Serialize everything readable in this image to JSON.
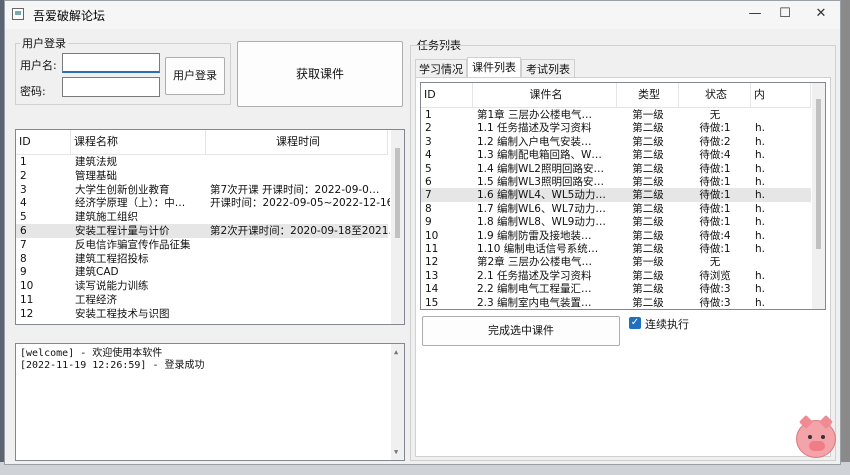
{
  "window": {
    "title": "吾爱破解论坛"
  },
  "login": {
    "group_title": "用户登录",
    "username_label": "用户名:",
    "username_value": "",
    "password_label": "密码:",
    "password_value": "",
    "login_button": "用户登录"
  },
  "get_courses_button": "获取课件",
  "courses": {
    "columns": [
      "ID",
      "课程名称",
      "课程时间"
    ],
    "rows": [
      [
        "1",
        "建筑法规",
        ""
      ],
      [
        "2",
        "管理基础",
        ""
      ],
      [
        "3",
        "大学生创新创业教育",
        "第7次开课   开课时间：2022-09-0…"
      ],
      [
        "4",
        "经济学原理（上）：中…",
        "开课时间：2022-09-05~2022-12-16"
      ],
      [
        "5",
        "建筑施工组织",
        ""
      ],
      [
        "6",
        "安装工程计量与计价",
        "第2次开课时间：2020-09-18至2021…"
      ],
      [
        "7",
        "反电信诈骗宣传作品征集",
        ""
      ],
      [
        "8",
        "建筑工程招投标",
        ""
      ],
      [
        "9",
        "建筑CAD",
        ""
      ],
      [
        "10",
        "读写说能力训练",
        ""
      ],
      [
        "11",
        "工程经济",
        ""
      ],
      [
        "12",
        "安装工程技术与识图",
        ""
      ]
    ]
  },
  "log": {
    "lines": [
      "[welcome] - 欢迎使用本软件",
      "[2022-11-19 12:26:59] - 登录成功"
    ]
  },
  "tasks": {
    "group_title": "任务列表",
    "tabs": [
      "学习情况",
      "课件列表",
      "考试列表"
    ],
    "columns": [
      "ID",
      "课件名",
      "类型",
      "状态",
      "内"
    ],
    "rows": [
      [
        "1",
        "第1章 三层办公楼电气…",
        "第一级",
        "无",
        ""
      ],
      [
        "2",
        "1.1 任务描述及学习资料",
        "第二级",
        "待做:1",
        "h."
      ],
      [
        "3",
        "1.2 编制入户电气安装…",
        "第二级",
        "待做:2",
        "h."
      ],
      [
        "4",
        "1.3 编制配电箱回路、W…",
        "第二级",
        "待做:4",
        "h."
      ],
      [
        "5",
        "1.4 编制WL2照明回路安…",
        "第二级",
        "待做:1",
        "h."
      ],
      [
        "6",
        "1.5 编制WL3照明回路安…",
        "第二级",
        "待做:1",
        "h."
      ],
      [
        "7",
        "1.6 编制WL4、WL5动力…",
        "第二级",
        "待做:1",
        "h."
      ],
      [
        "8",
        "1.7 编制WL6、WL7动力…",
        "第二级",
        "待做:1",
        "h."
      ],
      [
        "9",
        "1.8 编制WL8、WL9动力…",
        "第二级",
        "待做:1",
        "h."
      ],
      [
        "10",
        "1.9 编制防雷及接地装…",
        "第二级",
        "待做:4",
        "h."
      ],
      [
        "11",
        "1.10 编制电话信号系统…",
        "第二级",
        "待做:1",
        "h."
      ],
      [
        "12",
        "第2章 三层办公楼电气…",
        "第一级",
        "无",
        ""
      ],
      [
        "13",
        "2.1 任务描述及学习资料",
        "第二级",
        "待浏览",
        "h."
      ],
      [
        "14",
        "2.2 编制电气工程量汇…",
        "第二级",
        "待做:3",
        "h."
      ],
      [
        "15",
        "2.3 编制室内电气装置…",
        "第二级",
        "待做:3",
        "h."
      ]
    ],
    "complete_button": "完成选中课件",
    "continuous_label": "连续执行",
    "continuous_checked": true
  }
}
